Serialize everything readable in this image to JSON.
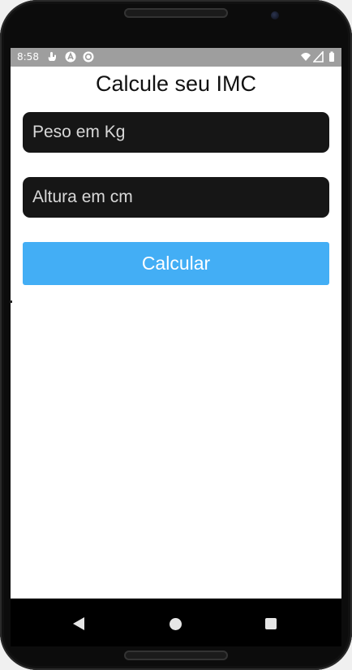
{
  "status_bar": {
    "time": "8:58",
    "left_icons": [
      "touch-icon",
      "react-icon",
      "sync-icon"
    ],
    "right_icons": [
      "wifi-icon",
      "signal-icon",
      "battery-icon"
    ]
  },
  "app": {
    "title": "Calcule seu IMC",
    "weight_placeholder": "Peso em Kg",
    "weight_value": "",
    "height_placeholder": "Altura em cm",
    "height_value": "",
    "button_label": "Calcular"
  },
  "colors": {
    "button": "#43aef5",
    "input_background": "#161616",
    "status_bar": "#9e9e9e",
    "nav_bar": "#000000"
  },
  "nav": [
    "back-icon",
    "home-icon",
    "recent-apps-icon"
  ]
}
